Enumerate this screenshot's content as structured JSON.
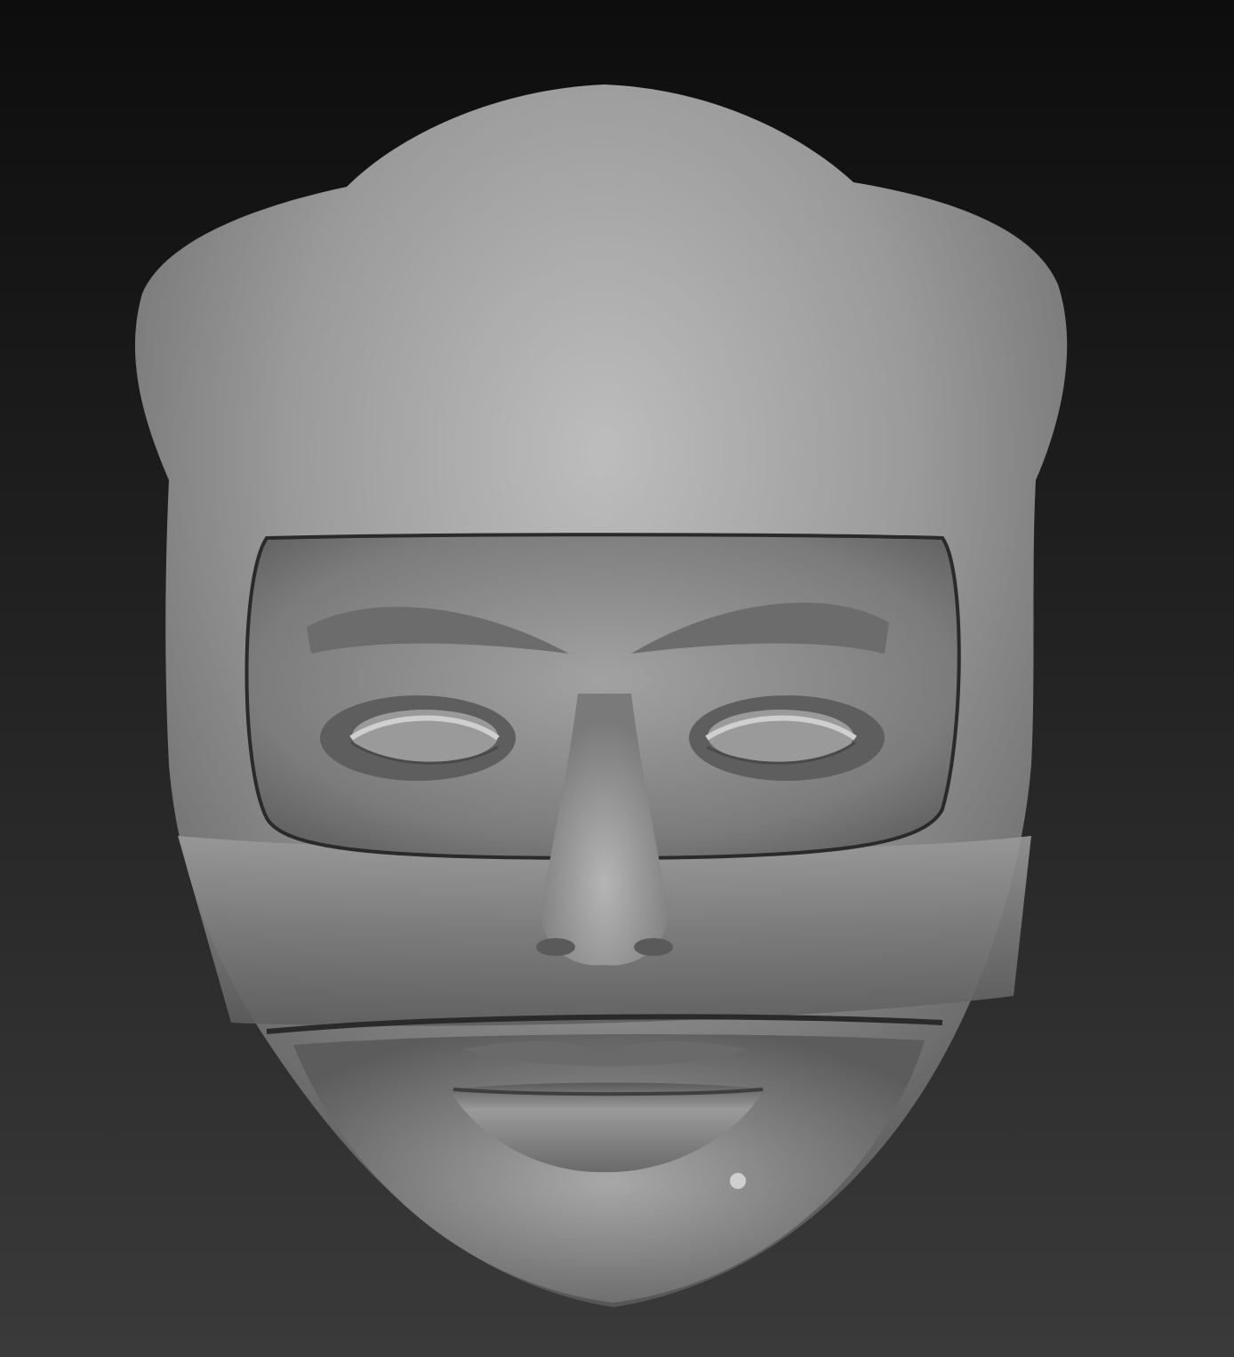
{
  "scene": {
    "subject": "sculpted-head-mesh",
    "colors": {
      "background_top": "#0d0d0d",
      "background_bottom": "#3a3a3a",
      "clay_light": "#bdbdbd",
      "clay_mid": "#8e8e8e",
      "clay_dark": "#4a4a4a"
    }
  }
}
